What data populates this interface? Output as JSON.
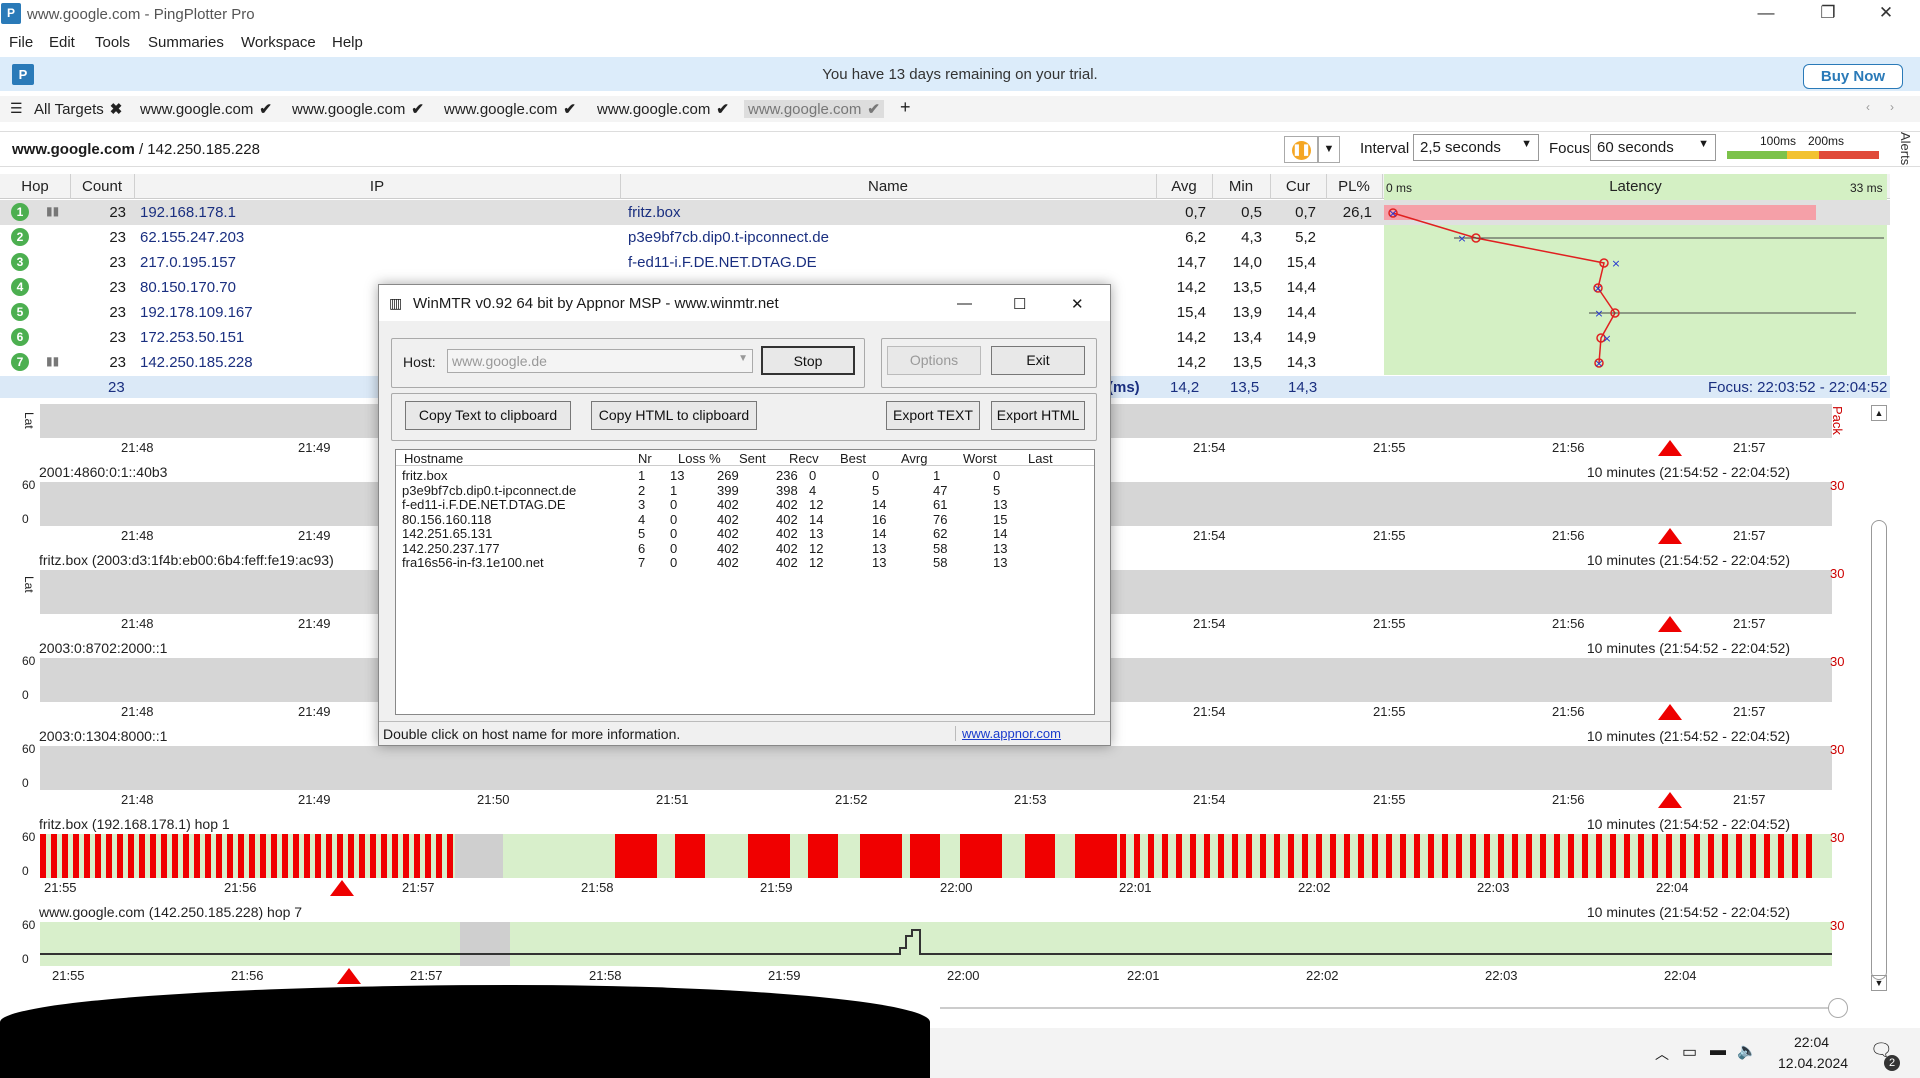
{
  "window": {
    "title": "www.google.com - PingPlotter Pro",
    "min": "—",
    "restore": "❐",
    "close": "✕"
  },
  "menu": [
    "File",
    "Edit",
    "Tools",
    "Summaries",
    "Workspace",
    "Help"
  ],
  "trial": {
    "message": "You have 13 days remaining on your trial.",
    "buy": "Buy Now"
  },
  "tabs": {
    "all": "All Targets",
    "items": [
      "www.google.com",
      "www.google.com",
      "www.google.com",
      "www.google.com",
      "www.google.com"
    ],
    "add": "+"
  },
  "target": {
    "host": "www.google.com",
    "ip": "/ 142.250.185.228",
    "interval_label": "Interval",
    "interval": "2,5 seconds",
    "focus_label": "Focus",
    "focus": "60 seconds",
    "legend_100": "100ms",
    "legend_200": "200ms",
    "alerts": "Alerts"
  },
  "grid": {
    "headers": {
      "hop": "Hop",
      "count": "Count",
      "ip": "IP",
      "name": "Name",
      "avg": "Avg",
      "min": "Min",
      "cur": "Cur",
      "pl": "PL%",
      "latency": "Latency",
      "lat_min": "0 ms",
      "lat_max": "33 ms"
    },
    "rows": [
      {
        "hop": "1",
        "count": "23",
        "ip": "192.168.178.1",
        "name": "fritz.box",
        "avg": "0,7",
        "min": "0,5",
        "cur": "0,7",
        "pl": "26,1"
      },
      {
        "hop": "2",
        "count": "23",
        "ip": "62.155.247.203",
        "name": "p3e9bf7cb.dip0.t-ipconnect.de",
        "avg": "6,2",
        "min": "4,3",
        "cur": "5,2",
        "pl": ""
      },
      {
        "hop": "3",
        "count": "23",
        "ip": "217.0.195.157",
        "name": "f-ed11-i.F.DE.NET.DTAG.DE",
        "avg": "14,7",
        "min": "14,0",
        "cur": "15,4",
        "pl": ""
      },
      {
        "hop": "4",
        "count": "23",
        "ip": "80.150.170.70",
        "name": "",
        "avg": "14,2",
        "min": "13,5",
        "cur": "14,4",
        "pl": ""
      },
      {
        "hop": "5",
        "count": "23",
        "ip": "192.178.109.167",
        "name": "",
        "avg": "15,4",
        "min": "13,9",
        "cur": "14,4",
        "pl": ""
      },
      {
        "hop": "6",
        "count": "23",
        "ip": "172.253.50.151",
        "name": "",
        "avg": "14,2",
        "min": "13,4",
        "cur": "14,9",
        "pl": ""
      },
      {
        "hop": "7",
        "count": "23",
        "ip": "142.250.185.228",
        "name": "",
        "avg": "14,2",
        "min": "13,5",
        "cur": "14,3",
        "pl": ""
      }
    ],
    "summary": {
      "count": "23",
      "label": "(ms)",
      "avg": "14,2",
      "min": "13,5",
      "cur": "14,3",
      "focus": "Focus: 22:03:52 - 22:04:52"
    }
  },
  "graphs": [
    {
      "title": "",
      "range": "",
      "ticks": [
        "21:48",
        "21:49",
        "21:54",
        "21:55",
        "21:56",
        "21:57"
      ]
    },
    {
      "title": "2001:4860:0:1::40b3",
      "range": "10 minutes (21:54:52 - 22:04:52)",
      "ticks": [
        "21:48",
        "21:49",
        "21:54",
        "21:55",
        "21:56",
        "21:57"
      ]
    },
    {
      "title": "fritz.box (2003:d3:1f4b:eb00:6b4:feff:fe19:ac93)",
      "range": "10 minutes (21:54:52 - 22:04:52)",
      "ticks": [
        "21:48",
        "21:49",
        "21:54",
        "21:55",
        "21:56",
        "21:57"
      ]
    },
    {
      "title": "2003:0:8702:2000::1",
      "range": "10 minutes (21:54:52 - 22:04:52)",
      "ticks": [
        "21:48",
        "21:49",
        "21:54",
        "21:55",
        "21:56",
        "21:57"
      ]
    },
    {
      "title": "2003:0:1304:8000::1",
      "range": "10 minutes (21:54:52 - 22:04:52)",
      "ticks": [
        "21:48",
        "21:49",
        "21:50",
        "21:51",
        "21:52",
        "21:53",
        "21:54",
        "21:55",
        "21:56",
        "21:57"
      ]
    },
    {
      "title": "fritz.box (192.168.178.1) hop 1",
      "range": "10 minutes (21:54:52 - 22:04:52)",
      "ticks": [
        "21:55",
        "21:56",
        "21:57",
        "21:58",
        "21:59",
        "22:00",
        "22:01",
        "22:02",
        "22:03",
        "22:04"
      ]
    },
    {
      "title": "www.google.com (142.250.185.228) hop 7",
      "range": "10 minutes (21:54:52 - 22:04:52)",
      "ticks": [
        "21:55",
        "21:56",
        "21:57",
        "21:58",
        "21:59",
        "22:00",
        "22:01",
        "22:02",
        "22:03",
        "22:04"
      ]
    }
  ],
  "graph_axis": {
    "y60": "60",
    "y0": "0",
    "lat": "Lat",
    "p30": "30",
    "pack": "Pack"
  },
  "winmtr": {
    "title": "WinMTR v0.92 64 bit by Appnor MSP - www.winmtr.net",
    "host_label": "Host:",
    "host_value": "www.google.de",
    "stop": "Stop",
    "options": "Options",
    "exit": "Exit",
    "copy_text": "Copy Text to clipboard",
    "copy_html": "Copy HTML to clipboard",
    "export_text": "Export TEXT",
    "export_html": "Export HTML",
    "columns": [
      "Hostname",
      "Nr",
      "Loss %",
      "Sent",
      "Recv",
      "Best",
      "Avrg",
      "Worst",
      "Last"
    ],
    "rows": [
      [
        "fritz.box",
        "1",
        "13",
        "269",
        "236",
        "0",
        "0",
        "1",
        "0"
      ],
      [
        "p3e9bf7cb.dip0.t-ipconnect.de",
        "2",
        "1",
        "399",
        "398",
        "4",
        "5",
        "47",
        "5"
      ],
      [
        "f-ed11-i.F.DE.NET.DTAG.DE",
        "3",
        "0",
        "402",
        "402",
        "12",
        "14",
        "61",
        "13"
      ],
      [
        "80.156.160.118",
        "4",
        "0",
        "402",
        "402",
        "14",
        "16",
        "76",
        "15"
      ],
      [
        "142.251.65.131",
        "5",
        "0",
        "402",
        "402",
        "13",
        "14",
        "62",
        "14"
      ],
      [
        "142.250.237.177",
        "6",
        "0",
        "402",
        "402",
        "12",
        "13",
        "58",
        "13"
      ],
      [
        "fra16s56-in-f3.1e100.net",
        "7",
        "0",
        "402",
        "402",
        "12",
        "13",
        "58",
        "13"
      ]
    ],
    "status": "Double click on host name for more information.",
    "link": "www.appnor.com"
  },
  "taskbar": {
    "time": "22:04",
    "date": "12.04.2024",
    "notif": "2"
  }
}
